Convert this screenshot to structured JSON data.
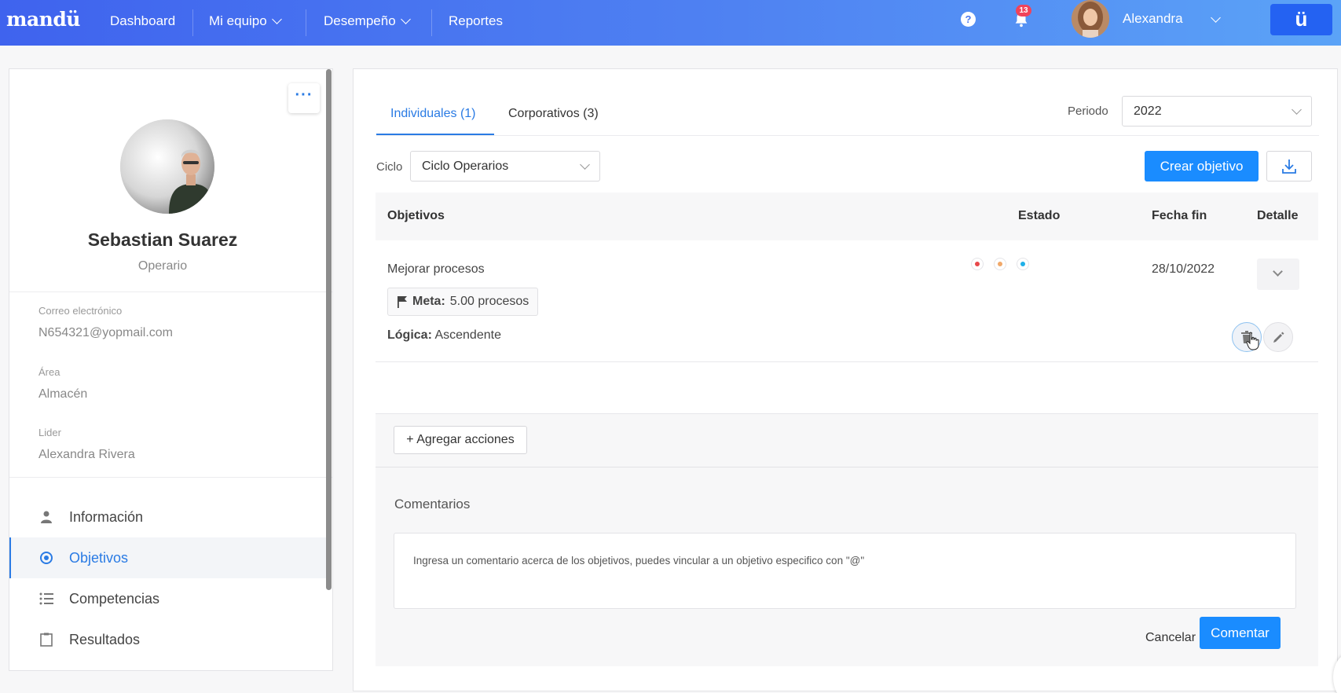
{
  "topnav": {
    "logo": "mandü",
    "items": [
      {
        "label": "Dashboard"
      },
      {
        "label": "Mi equipo"
      },
      {
        "label": "Desempeño"
      },
      {
        "label": "Reportes"
      }
    ],
    "help_glyph": "?",
    "notifications_count": "13",
    "user_name": "Alexandra",
    "brand_glyph": "ü",
    "accent": "#3f63ee"
  },
  "profile": {
    "more_glyph": "···",
    "name": "Sebastian Suarez",
    "role": "Operario",
    "fields": [
      {
        "label": "Correo electrónico",
        "value": "N654321@yopmail.com"
      },
      {
        "label": "Área",
        "value": "Almacén"
      },
      {
        "label": "Lider",
        "value": "Alexandra Rivera"
      }
    ],
    "menu": [
      {
        "label": "Información",
        "icon": "user-icon"
      },
      {
        "label": "Objetivos",
        "icon": "target-icon",
        "active": true
      },
      {
        "label": "Competencias",
        "icon": "list-icon"
      },
      {
        "label": "Resultados",
        "icon": "clipboard-icon"
      }
    ]
  },
  "main": {
    "tabs": [
      {
        "label": "Individuales (1)",
        "active": true
      },
      {
        "label": "Corporativos (3)"
      }
    ],
    "periodo_label": "Periodo",
    "periodo_value": "2022",
    "ciclo_label": "Ciclo",
    "ciclo_value": "Ciclo Operarios",
    "create_button": "Crear objetivo",
    "table": {
      "headers": [
        "Objetivos",
        "Estado",
        "Fecha fin",
        "Detalle"
      ],
      "rows": [
        {
          "objetivo": "Mejorar procesos",
          "meta_label": "Meta:",
          "meta_value": "5.00 procesos",
          "logica_label": "Lógica:",
          "logica_value": "Ascendente",
          "estado_colors": [
            "#e8484a",
            "#f0a86a",
            "#1fb0e8"
          ],
          "fecha_fin": "28/10/2022"
        }
      ]
    },
    "add_actions_button": "+ Agregar acciones",
    "comments_title": "Comentarios",
    "comment_placeholder": "Ingresa un comentario acerca de los objetivos, puedes vincular a un objetivo especifico con \"@\"",
    "cancel_label": "Cancelar",
    "comment_button": "Comentar",
    "primary_color": "#1a8cff"
  }
}
